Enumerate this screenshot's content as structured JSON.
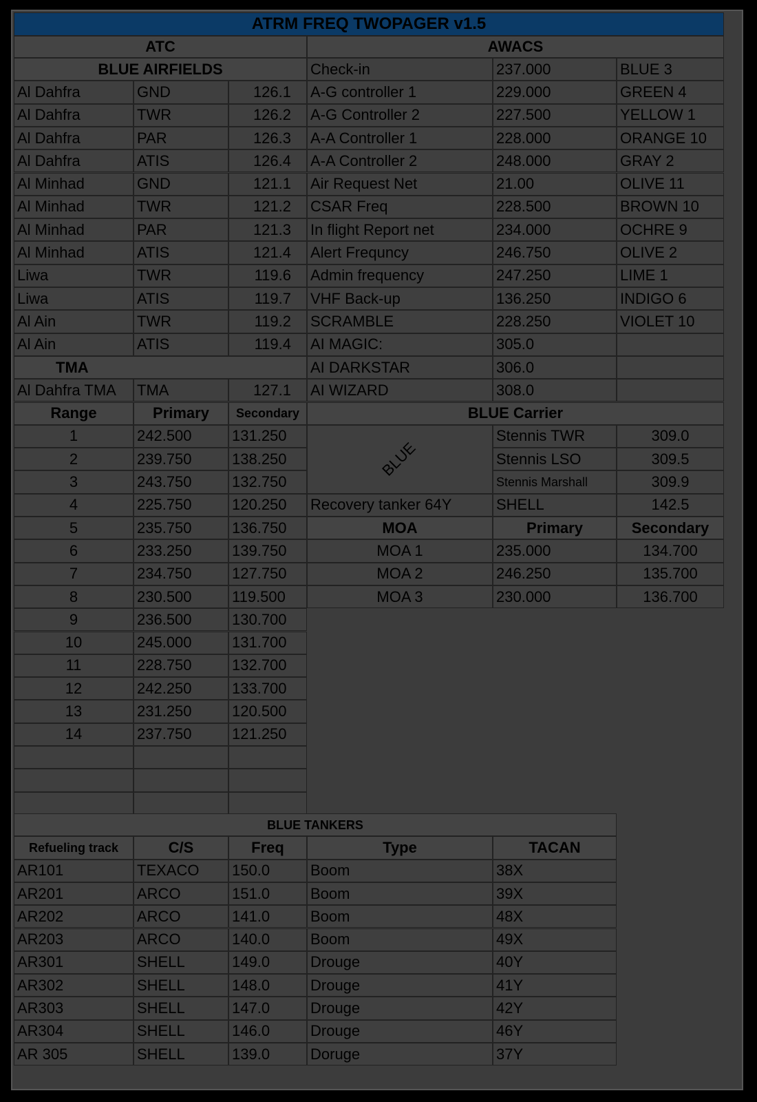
{
  "title": "ATRM FREQ TWOPAGER v1.5",
  "atc": {
    "header": "ATC",
    "airfields_header": "BLUE AIRFIELDS",
    "airfields": [
      [
        "Al Dahfra",
        "GND",
        "126.1"
      ],
      [
        "Al Dahfra",
        "TWR",
        "126.2"
      ],
      [
        "Al Dahfra",
        "PAR",
        "126.3"
      ],
      [
        "Al Dahfra",
        "ATIS",
        "126.4"
      ],
      [
        "Al Minhad",
        "GND",
        "121.1"
      ],
      [
        "Al Minhad",
        "TWR",
        "121.2"
      ],
      [
        "Al Minhad",
        "PAR",
        "121.3"
      ],
      [
        "Al Minhad",
        "ATIS",
        "121.4"
      ],
      [
        "Liwa",
        "TWR",
        "119.6"
      ],
      [
        "Liwa",
        "ATIS",
        "119.7"
      ],
      [
        "Al Ain",
        "TWR",
        "119.2"
      ],
      [
        "Al Ain",
        "ATIS",
        "119.4"
      ]
    ],
    "tma_header": "TMA",
    "tma": [
      "Al Dahfra TMA",
      "TMA",
      "127.1"
    ]
  },
  "ranges": {
    "headers": [
      "Range",
      "Primary",
      "Secondary"
    ],
    "rows": [
      [
        "1",
        "242.500",
        "131.250"
      ],
      [
        "2",
        "239.750",
        "138.250"
      ],
      [
        "3",
        "243.750",
        "132.750"
      ],
      [
        "4",
        "225.750",
        "120.250"
      ],
      [
        "5",
        "235.750",
        "136.750"
      ],
      [
        "6",
        "233.250",
        "139.750"
      ],
      [
        "7",
        "234.750",
        "127.750"
      ],
      [
        "8",
        "230.500",
        "119.500"
      ],
      [
        "9",
        "236.500",
        "130.700"
      ],
      [
        "10",
        "245.000",
        "131.700"
      ],
      [
        "11",
        "228.750",
        "132.700"
      ],
      [
        "12",
        "242.250",
        "133.700"
      ],
      [
        "13",
        "231.250",
        "120.500"
      ],
      [
        "14",
        "237.750",
        "121.250"
      ]
    ]
  },
  "awacs": {
    "header": "AWACS",
    "rows": [
      [
        "Check-in",
        "237.000",
        "BLUE 3"
      ],
      [
        "A-G controller 1",
        "229.000",
        "GREEN 4"
      ],
      [
        "A-G Controller 2",
        "227.500",
        "YELLOW 1"
      ],
      [
        "A-A Controller 1",
        "228.000",
        "ORANGE 10"
      ],
      [
        "A-A Controller 2",
        "248.000",
        "GRAY 2"
      ],
      [
        "Air Request Net",
        "21.00",
        "OLIVE 11"
      ],
      [
        "CSAR Freq",
        "228.500",
        "BROWN 10"
      ],
      [
        "In flight Report net",
        "234.000",
        "OCHRE 9"
      ],
      [
        "Alert Frequncy",
        "246.750",
        "OLIVE 2"
      ],
      [
        "Admin frequency",
        "247.250",
        "LIME 1"
      ],
      [
        "VHF Back-up",
        "136.250",
        "INDIGO 6"
      ],
      [
        "SCRAMBLE",
        "228.250",
        "VIOLET 10"
      ],
      [
        "AI MAGIC:",
        "305.0",
        ""
      ],
      [
        "AI DARKSTAR",
        "306.0",
        ""
      ],
      [
        "AI WIZARD",
        "308.0",
        ""
      ]
    ]
  },
  "carrier": {
    "header": "BLUE Carrier",
    "side_label": "BLUE",
    "rows": [
      [
        "Stennis TWR",
        "309.0"
      ],
      [
        "Stennis LSO",
        "309.5"
      ],
      [
        "Stennis Marshall",
        "309.9"
      ]
    ],
    "tanker": [
      "Recovery tanker 64Y",
      "SHELL",
      "142.5"
    ]
  },
  "moa": {
    "headers": [
      "MOA",
      "Primary",
      "Secondary"
    ],
    "rows": [
      [
        "MOA 1",
        "235.000",
        "134.700"
      ],
      [
        "MOA 2",
        "246.250",
        "135.700"
      ],
      [
        "MOA 3",
        "230.000",
        "136.700"
      ]
    ]
  },
  "tankers": {
    "header": "BLUE TANKERS",
    "columns": [
      "Refueling track",
      "C/S",
      "Freq",
      "Type",
      "TACAN"
    ],
    "rows": [
      [
        "AR101",
        "TEXACO",
        "150.0",
        "Boom",
        "38X"
      ],
      [
        "AR201",
        "ARCO",
        "151.0",
        "Boom",
        "39X"
      ],
      [
        "AR202",
        "ARCO",
        "141.0",
        "Boom",
        "48X"
      ],
      [
        "AR203",
        "ARCO",
        "140.0",
        "Boom",
        "49X"
      ],
      [
        "AR301",
        "SHELL",
        "149.0",
        "Drouge",
        "40Y"
      ],
      [
        "AR302",
        "SHELL",
        "148.0",
        "Drouge",
        "41Y"
      ],
      [
        "AR303",
        "SHELL",
        "147.0",
        "Drouge",
        "42Y"
      ],
      [
        "AR304",
        "SHELL",
        "146.0",
        "Drouge",
        "46Y"
      ],
      [
        "AR 305",
        "SHELL",
        "139.0",
        "Doruge",
        "37Y"
      ]
    ]
  }
}
